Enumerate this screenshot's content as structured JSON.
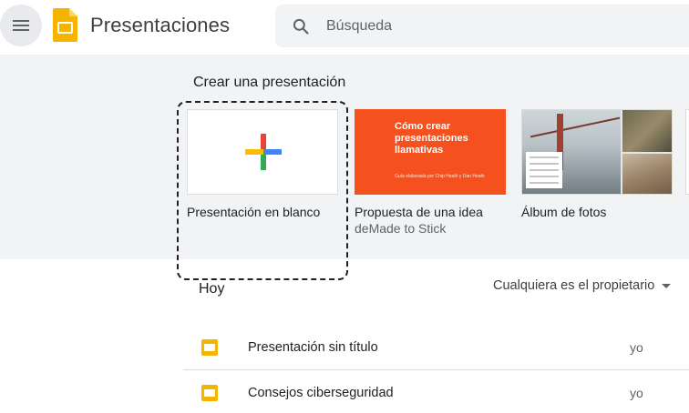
{
  "header": {
    "app_title": "Presentaciones",
    "search_placeholder": "Búsqueda"
  },
  "gallery": {
    "title": "Crear una presentación",
    "templates": [
      {
        "name": "Presentación en blanco",
        "subtitle": ""
      },
      {
        "name": "Propuesta de una idea",
        "subtitle": "deMade to Stick",
        "thumb_title": "Cómo crear presentaciones llamativas",
        "thumb_subtitle": "Guía elaborada por Chip Heath y Dan Heath"
      },
      {
        "name": "Álbum de fotos",
        "subtitle": ""
      }
    ]
  },
  "recent": {
    "section_title": "Hoy",
    "owner_filter": "Cualquiera es el propietario",
    "documents": [
      {
        "title": "Presentación sin título",
        "owner": "yo"
      },
      {
        "title": "Consejos ciberseguridad",
        "owner": "yo"
      }
    ]
  },
  "colors": {
    "slides_yellow": "#f4b400",
    "idea_orange": "#f4511e",
    "gallery_bg": "#f1f3f4"
  },
  "icons": [
    "menu-icon",
    "slides-logo-icon",
    "search-icon",
    "plus-icon",
    "dropdown-caret-icon",
    "slides-file-icon"
  ]
}
